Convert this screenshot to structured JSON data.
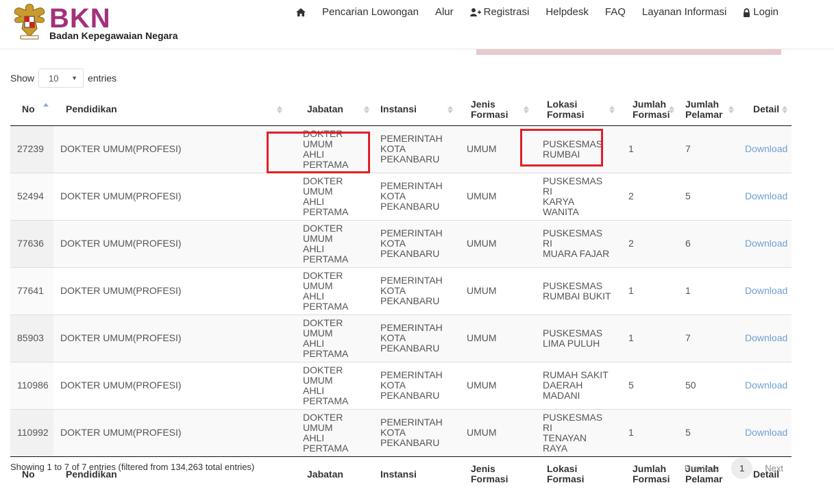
{
  "brand": {
    "name": "BKN",
    "subtitle": "Badan Kepegawaian Negara"
  },
  "nav": {
    "home_icon": "home-icon",
    "items": [
      "Pencarian Lowongan",
      "Alur",
      "Registrasi",
      "Helpdesk",
      "FAQ",
      "Layanan Informasi",
      "Login"
    ]
  },
  "length": {
    "show": "Show",
    "value": "10",
    "entries": "entries"
  },
  "table": {
    "headers": {
      "no": "No",
      "pendidikan": "Pendidikan",
      "jabatan": "Jabatan",
      "instansi": "Instansi",
      "jenis_1": "Jenis",
      "jenis_2": "Formasi",
      "lokasi_1": "Lokasi",
      "lokasi_2": "Formasi",
      "jformasi_1": "Jumlah",
      "jformasi_2": "Formasi",
      "jpelamar_1": "Jumlah",
      "jpelamar_2": "Pelamar",
      "detail": "Detail"
    },
    "rows": [
      {
        "no": "27239",
        "pendidikan": "DOKTER UMUM(PROFESI)",
        "jabatan": [
          "DOKTER UMUM",
          "AHLI PERTAMA"
        ],
        "instansi": [
          "PEMERINTAH",
          "KOTA",
          "PEKANBARU"
        ],
        "jenis": "UMUM",
        "lokasi": [
          "PUSKESMAS",
          "RUMBAI"
        ],
        "jumlah_formasi": "1",
        "jumlah_pelamar": "7",
        "detail": "Download"
      },
      {
        "no": "52494",
        "pendidikan": "DOKTER UMUM(PROFESI)",
        "jabatan": [
          "DOKTER UMUM",
          "AHLI PERTAMA"
        ],
        "instansi": [
          "PEMERINTAH",
          "KOTA",
          "PEKANBARU"
        ],
        "jenis": "UMUM",
        "lokasi": [
          "PUSKESMAS RI",
          "KARYA WANITA"
        ],
        "jumlah_formasi": "2",
        "jumlah_pelamar": "5",
        "detail": "Download"
      },
      {
        "no": "77636",
        "pendidikan": "DOKTER UMUM(PROFESI)",
        "jabatan": [
          "DOKTER UMUM",
          "AHLI PERTAMA"
        ],
        "instansi": [
          "PEMERINTAH",
          "KOTA",
          "PEKANBARU"
        ],
        "jenis": "UMUM",
        "lokasi": [
          "PUSKESMAS RI",
          "MUARA FAJAR"
        ],
        "jumlah_formasi": "2",
        "jumlah_pelamar": "6",
        "detail": "Download"
      },
      {
        "no": "77641",
        "pendidikan": "DOKTER UMUM(PROFESI)",
        "jabatan": [
          "DOKTER UMUM",
          "AHLI PERTAMA"
        ],
        "instansi": [
          "PEMERINTAH",
          "KOTA",
          "PEKANBARU"
        ],
        "jenis": "UMUM",
        "lokasi": [
          "PUSKESMAS",
          "RUMBAI BUKIT"
        ],
        "jumlah_formasi": "1",
        "jumlah_pelamar": "1",
        "detail": "Download"
      },
      {
        "no": "85903",
        "pendidikan": "DOKTER UMUM(PROFESI)",
        "jabatan": [
          "DOKTER UMUM",
          "AHLI PERTAMA"
        ],
        "instansi": [
          "PEMERINTAH",
          "KOTA",
          "PEKANBARU"
        ],
        "jenis": "UMUM",
        "lokasi": [
          "PUSKESMAS",
          "LIMA PULUH"
        ],
        "jumlah_formasi": "1",
        "jumlah_pelamar": "7",
        "detail": "Download"
      },
      {
        "no": "110986",
        "pendidikan": "DOKTER UMUM(PROFESI)",
        "jabatan": [
          "DOKTER UMUM",
          "AHLI PERTAMA"
        ],
        "instansi": [
          "PEMERINTAH",
          "KOTA",
          "PEKANBARU"
        ],
        "jenis": "UMUM",
        "lokasi": [
          "RUMAH SAKIT",
          "DAERAH",
          "MADANI"
        ],
        "jumlah_formasi": "5",
        "jumlah_pelamar": "50",
        "detail": "Download"
      },
      {
        "no": "110992",
        "pendidikan": "DOKTER UMUM(PROFESI)",
        "jabatan": [
          "DOKTER UMUM",
          "AHLI PERTAMA"
        ],
        "instansi": [
          "PEMERINTAH",
          "KOTA",
          "PEKANBARU"
        ],
        "jenis": "UMUM",
        "lokasi": [
          "PUSKESMAS RI",
          "TENAYAN RAYA"
        ],
        "jumlah_formasi": "1",
        "jumlah_pelamar": "5",
        "detail": "Download"
      }
    ]
  },
  "info": "Showing 1 to 7 of 7 entries (filtered from 134,263 total entries)",
  "pagination": {
    "previous": "Previous",
    "current": "1",
    "next": "Next"
  },
  "colors": {
    "brand": "#a4307a",
    "link": "#6f9fd1",
    "highlight": "#e11f26"
  }
}
